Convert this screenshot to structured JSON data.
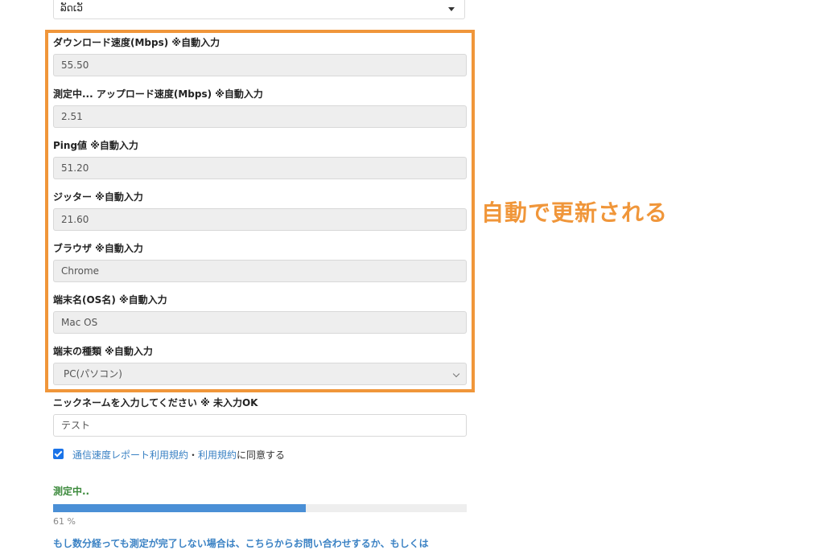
{
  "top_select": {
    "value": "ລັດເວັ"
  },
  "fields": [
    {
      "label": "ダウンロード速度(Mbps) ※自動入力",
      "value": "55.50"
    },
    {
      "label": "測定中... アップロード速度(Mbps) ※自動入力",
      "value": "2.51"
    },
    {
      "label": "Ping値 ※自動入力",
      "value": "51.20"
    },
    {
      "label": "ジッター ※自動入力",
      "value": "21.60"
    },
    {
      "label": "ブラウザ ※自動入力",
      "value": "Chrome"
    },
    {
      "label": "端末名(OS名) ※自動入力",
      "value": "Mac OS"
    },
    {
      "label": "端末の種類 ※自動入力",
      "value": "PC(パソコン)"
    }
  ],
  "annotation": "自動で更新される",
  "nickname": {
    "label": "ニックネームを入力してください ※ 未入力OK",
    "value": "テスト"
  },
  "consent": {
    "checked": true,
    "link1": "通信速度レポート利用規約",
    "separator": "・",
    "link2": "利用規約",
    "suffix": "に同意する"
  },
  "status_text": "測定中..",
  "progress": {
    "percent": 61,
    "label": "61 %"
  },
  "footer_text": "もし数分経っても測定が完了しない場合は、こちらからお問い合わせするか、もしくは",
  "colors": {
    "accent": "#f0963a",
    "progress": "#4a8fd6",
    "link": "#3b82c4",
    "status": "#3c8a3c"
  }
}
